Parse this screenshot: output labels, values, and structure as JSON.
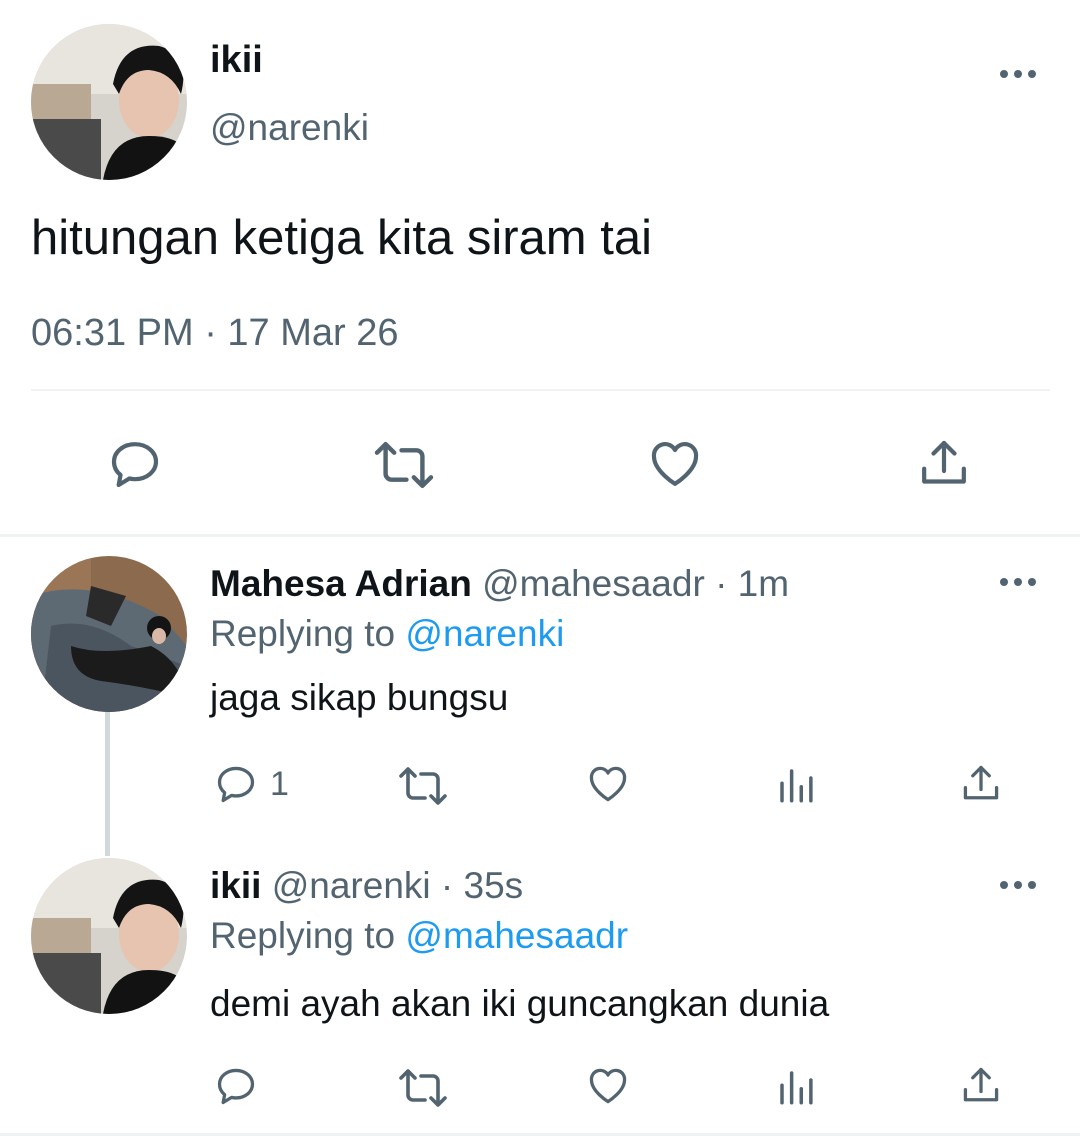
{
  "main_tweet": {
    "name": "ikii",
    "handle": "@narenki",
    "text": "hitungan ketiga kita siram tai",
    "timestamp": "06:31 PM · 17 Mar 26",
    "actions": [
      "reply-icon",
      "retweet-icon",
      "like-icon",
      "share-icon"
    ]
  },
  "replies": [
    {
      "name": "Mahesa Adrian",
      "handle": "@mahesaadr",
      "time": "· 1m",
      "replying_prefix": "Replying to",
      "replying_handle": "@narenki",
      "text": "jaga sikap bungsu",
      "reply_count": "1",
      "actions": [
        "reply-icon",
        "retweet-icon",
        "like-icon",
        "analytics-icon",
        "share-icon"
      ]
    },
    {
      "name": "ikii",
      "handle": "@narenki",
      "time": "· 35s",
      "replying_prefix": "Replying to",
      "replying_handle": "@mahesaadr",
      "text": "demi ayah akan iki guncangkan dunia",
      "reply_count": "",
      "actions": [
        "reply-icon",
        "retweet-icon",
        "like-icon",
        "analytics-icon",
        "share-icon"
      ]
    }
  ],
  "colors": {
    "text": "#0f1419",
    "muted": "#536471",
    "link": "#1d9bf0",
    "divider": "#eff3f4",
    "thread_line": "#cfd9de"
  }
}
